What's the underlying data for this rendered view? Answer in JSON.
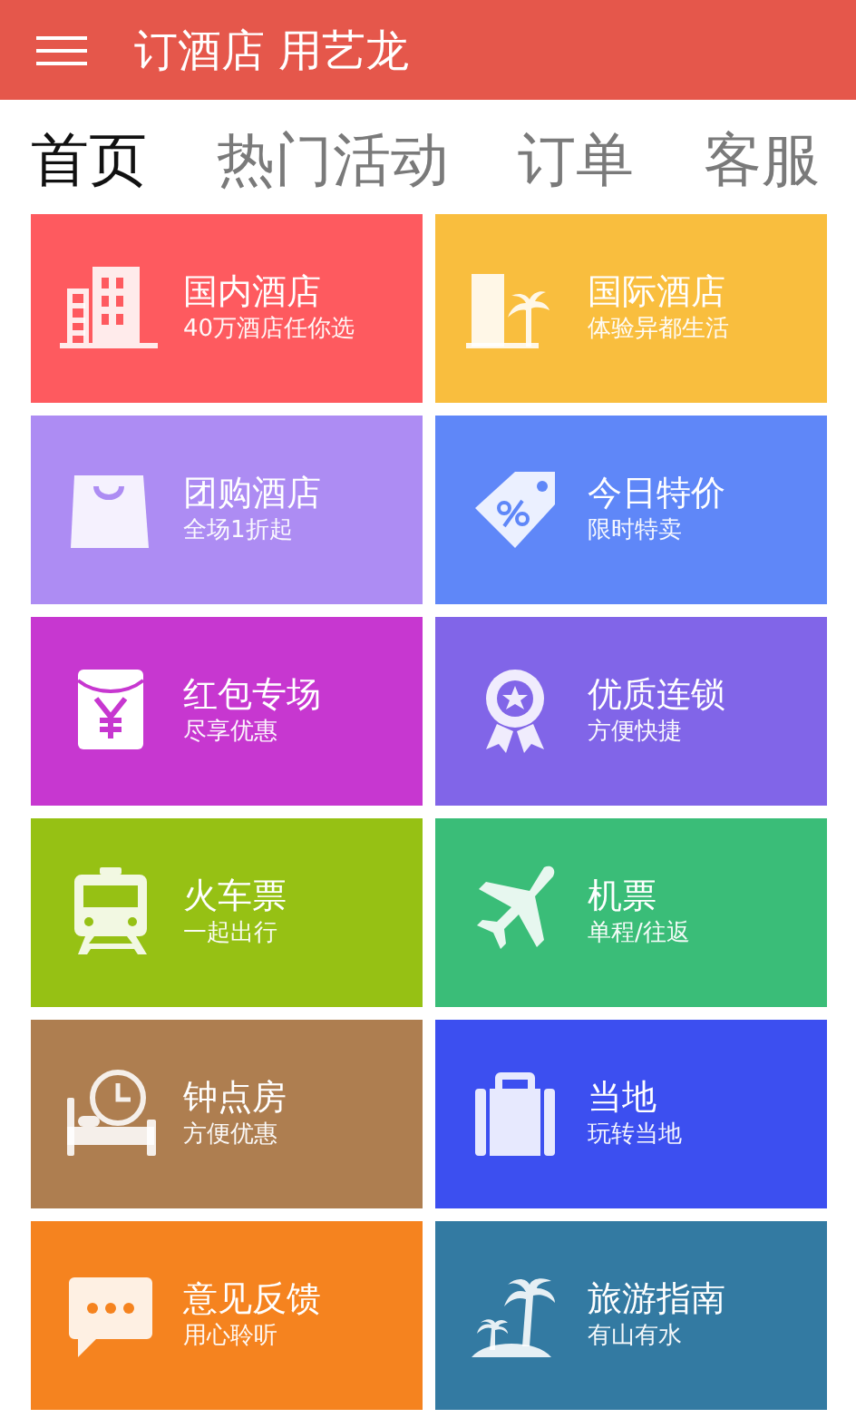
{
  "header": {
    "title": "订酒店 用艺龙"
  },
  "tabs": [
    {
      "label": "首页",
      "selected": true
    },
    {
      "label": "热门活动",
      "selected": false
    },
    {
      "label": "订单",
      "selected": false
    },
    {
      "label": "客服",
      "selected": false
    }
  ],
  "tiles": [
    {
      "kind": "hotel",
      "title": "国内酒店",
      "subtitle": "40万酒店任你选",
      "color": "#fe5a5f"
    },
    {
      "kind": "resort",
      "title": "国际酒店",
      "subtitle": "体验异都生活",
      "color": "#f9be3e"
    },
    {
      "kind": "bag",
      "title": "团购酒店",
      "subtitle": "全场1折起",
      "color": "#ad8cf3"
    },
    {
      "kind": "tag",
      "title": "今日特价",
      "subtitle": "限时特卖",
      "color": "#5f87f8"
    },
    {
      "kind": "envelope",
      "title": "红包专场",
      "subtitle": "尽享优惠",
      "color": "#c737d0"
    },
    {
      "kind": "award",
      "title": "优质连锁",
      "subtitle": "方便快捷",
      "color": "#8165e8"
    },
    {
      "kind": "train",
      "title": "火车票",
      "subtitle": "一起出行",
      "color": "#96c114"
    },
    {
      "kind": "plane",
      "title": "机票",
      "subtitle": "单程/往返",
      "color": "#3abd78"
    },
    {
      "kind": "bed",
      "title": "钟点房",
      "subtitle": "方便优惠",
      "color": "#ae7e50"
    },
    {
      "kind": "suitcase",
      "title": "当地",
      "subtitle": "玩转当地",
      "color": "#3c4ff0"
    },
    {
      "kind": "chat",
      "title": "意见反馈",
      "subtitle": "用心聆听",
      "color": "#f5831f"
    },
    {
      "kind": "island",
      "title": "旅游指南",
      "subtitle": "有山有水",
      "color": "#337aa2"
    }
  ]
}
